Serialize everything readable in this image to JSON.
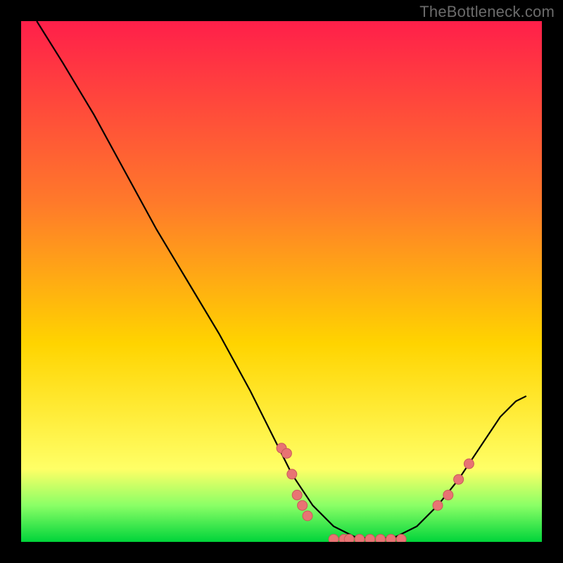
{
  "watermark": "TheBottleneck.com",
  "colors": {
    "bg_black": "#000000",
    "curve": "#000000",
    "marker_fill": "#e87373",
    "marker_stroke": "#c85a5a",
    "grad_top": "#ff1f4a",
    "grad_mid1": "#ff7a2a",
    "grad_mid2": "#ffd400",
    "grad_low": "#ffff66",
    "grad_green_top": "#8aff66",
    "grad_green_bot": "#00d43a"
  },
  "chart_data": {
    "type": "line",
    "title": "",
    "xlabel": "",
    "ylabel": "",
    "xlim": [
      0,
      100
    ],
    "ylim": [
      0,
      100
    ],
    "curve": [
      {
        "x": 3,
        "y": 100
      },
      {
        "x": 8,
        "y": 92
      },
      {
        "x": 14,
        "y": 82
      },
      {
        "x": 20,
        "y": 71
      },
      {
        "x": 26,
        "y": 60
      },
      {
        "x": 32,
        "y": 50
      },
      {
        "x": 38,
        "y": 40
      },
      {
        "x": 44,
        "y": 29
      },
      {
        "x": 48,
        "y": 21
      },
      {
        "x": 52,
        "y": 13
      },
      {
        "x": 56,
        "y": 7
      },
      {
        "x": 60,
        "y": 3
      },
      {
        "x": 64,
        "y": 1
      },
      {
        "x": 68,
        "y": 0.5
      },
      {
        "x": 72,
        "y": 1
      },
      {
        "x": 76,
        "y": 3
      },
      {
        "x": 80,
        "y": 7
      },
      {
        "x": 84,
        "y": 12
      },
      {
        "x": 88,
        "y": 18
      },
      {
        "x": 92,
        "y": 24
      },
      {
        "x": 95,
        "y": 27
      },
      {
        "x": 97,
        "y": 28
      }
    ],
    "markers": [
      {
        "x": 50,
        "y": 18
      },
      {
        "x": 51,
        "y": 17
      },
      {
        "x": 52,
        "y": 13
      },
      {
        "x": 53,
        "y": 9
      },
      {
        "x": 54,
        "y": 7
      },
      {
        "x": 55,
        "y": 5
      },
      {
        "x": 60,
        "y": 0.5
      },
      {
        "x": 62,
        "y": 0.5
      },
      {
        "x": 63,
        "y": 0.5
      },
      {
        "x": 65,
        "y": 0.5
      },
      {
        "x": 67,
        "y": 0.5
      },
      {
        "x": 69,
        "y": 0.5
      },
      {
        "x": 71,
        "y": 0.5
      },
      {
        "x": 73,
        "y": 0.5
      },
      {
        "x": 80,
        "y": 7
      },
      {
        "x": 82,
        "y": 9
      },
      {
        "x": 84,
        "y": 12
      },
      {
        "x": 86,
        "y": 15
      }
    ]
  }
}
